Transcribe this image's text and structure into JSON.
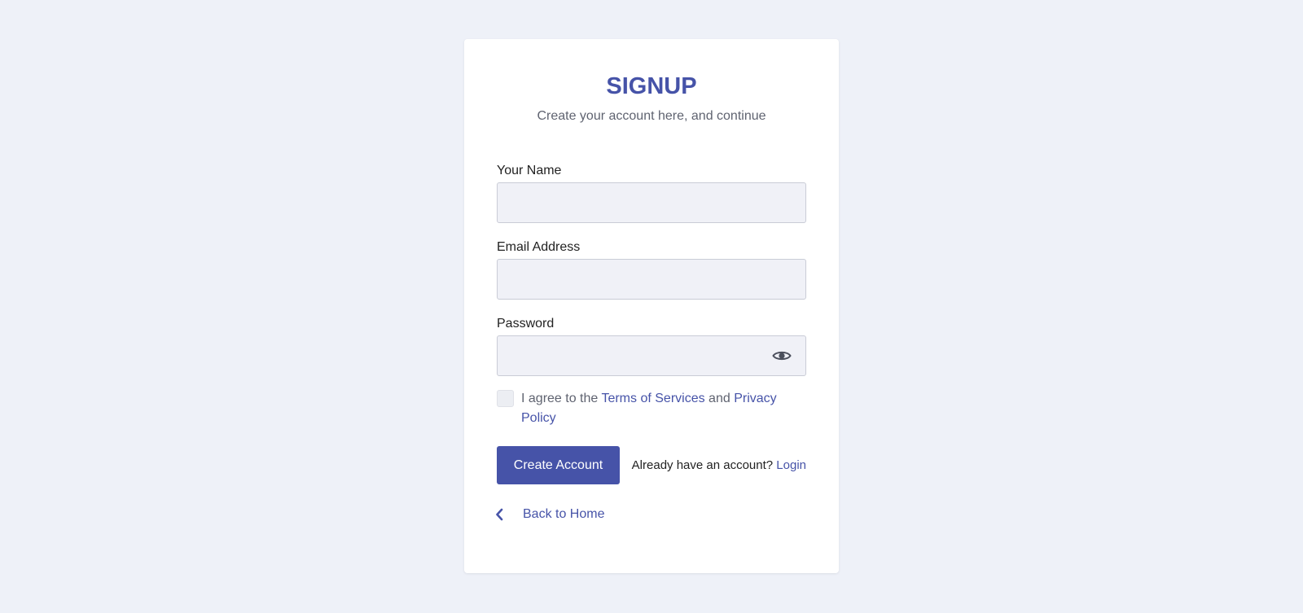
{
  "signup": {
    "title": "SIGNUP",
    "subtitle": "Create your account here, and continue",
    "fields": {
      "name": {
        "label": "Your Name",
        "value": "",
        "placeholder": ""
      },
      "email": {
        "label": "Email Address",
        "value": "",
        "placeholder": ""
      },
      "password": {
        "label": "Password",
        "value": "",
        "placeholder": ""
      }
    },
    "agreement": {
      "prefix": "I agree to the ",
      "terms_link": "Terms of Services",
      "joiner": " and ",
      "privacy_link": "Privacy Policy"
    },
    "create_button": "Create Account",
    "login_prompt": "Already have an account? ",
    "login_link": "Login",
    "back_link": "Back to Home"
  },
  "icons": {
    "password_toggle": "eye-icon",
    "back": "chevron-left-icon"
  },
  "colors": {
    "accent": "#4653a8",
    "background": "#eef1f8",
    "card": "#ffffff",
    "input_bg": "#f0f1f7",
    "muted_text": "#5f6370"
  }
}
